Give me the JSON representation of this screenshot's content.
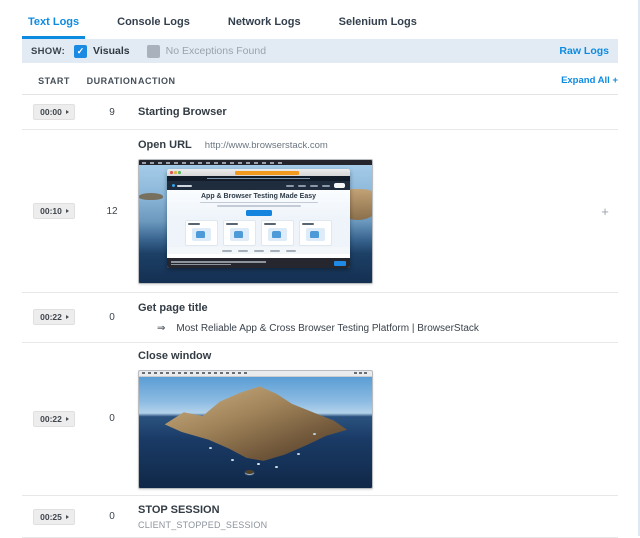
{
  "accent_color": "#0d8be0",
  "tabs": [
    {
      "label": "Text Logs",
      "active": true
    },
    {
      "label": "Console Logs",
      "active": false
    },
    {
      "label": "Network Logs",
      "active": false
    },
    {
      "label": "Selenium Logs",
      "active": false
    }
  ],
  "show_bar": {
    "label": "SHOW:",
    "filters": [
      {
        "label": "Visuals",
        "checked": true,
        "check_glyph": "✓"
      },
      {
        "label": "No Exceptions Found",
        "checked": false,
        "check_glyph": ""
      }
    ],
    "raw_logs_label": "Raw Logs"
  },
  "log_table": {
    "columns": {
      "start": "START",
      "duration": "DURATION",
      "action": "ACTION"
    },
    "expand_all_label": "Expand All +",
    "rows": [
      {
        "start": "00:00",
        "duration": "9",
        "title": "Starting Browser"
      },
      {
        "start": "00:10",
        "duration": "12",
        "title": "Open URL",
        "detail": "http://www.browserstack.com",
        "expand_label": "+",
        "screenshot": {
          "name": "browserstack-homepage-screenshot",
          "hero_title": "App & Browser Testing Made Easy"
        }
      },
      {
        "start": "00:22",
        "duration": "0",
        "title": "Get page title",
        "result_arrow": "⇒",
        "result_text": "Most Reliable App & Cross Browser Testing Platform | BrowserStack"
      },
      {
        "start": "00:22",
        "duration": "0",
        "title": "Close window",
        "screenshot": {
          "name": "macos-desktop-screenshot"
        }
      },
      {
        "start": "00:25",
        "duration": "0",
        "title": "STOP SESSION",
        "subtitle": "CLIENT_STOPPED_SESSION"
      }
    ]
  }
}
